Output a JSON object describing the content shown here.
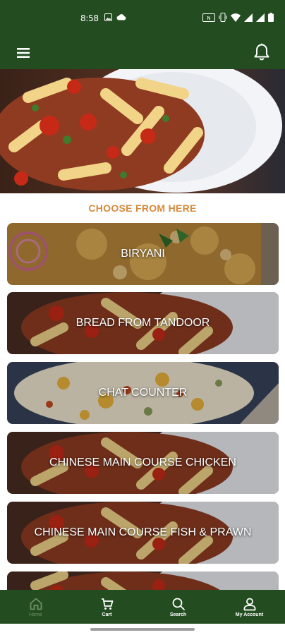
{
  "status_bar": {
    "time": "8:58",
    "left_icons": [
      "image-icon",
      "cloud-icon"
    ],
    "right_icons": [
      "nfc-icon",
      "vibrate-icon",
      "wifi-icon",
      "signal-icon",
      "signal-icon",
      "battery-icon"
    ]
  },
  "app_bar": {
    "menu_icon": "menu-icon",
    "notification_icon": "bell-icon"
  },
  "colors": {
    "brand_green": "#234d20",
    "accent_orange": "#d68a3c",
    "inactive_nav": "#6f8f6a"
  },
  "section": {
    "title": "CHOOSE FROM HERE"
  },
  "categories": [
    {
      "label": "BIRYANI"
    },
    {
      "label": "BREAD FROM TANDOOR"
    },
    {
      "label": "CHAT COUNTER"
    },
    {
      "label": "CHINESE MAIN COURSE CHICKEN"
    },
    {
      "label": "CHINESE MAIN COURSE FISH & PRAWN"
    },
    {
      "label": ""
    }
  ],
  "bottom_nav": {
    "items": [
      {
        "label": "Home",
        "icon": "home-icon",
        "active": true
      },
      {
        "label": "Cart",
        "icon": "cart-icon",
        "active": false
      },
      {
        "label": "Search",
        "icon": "search-icon",
        "active": false
      },
      {
        "label": "My Account",
        "icon": "user-icon",
        "active": false
      }
    ]
  }
}
